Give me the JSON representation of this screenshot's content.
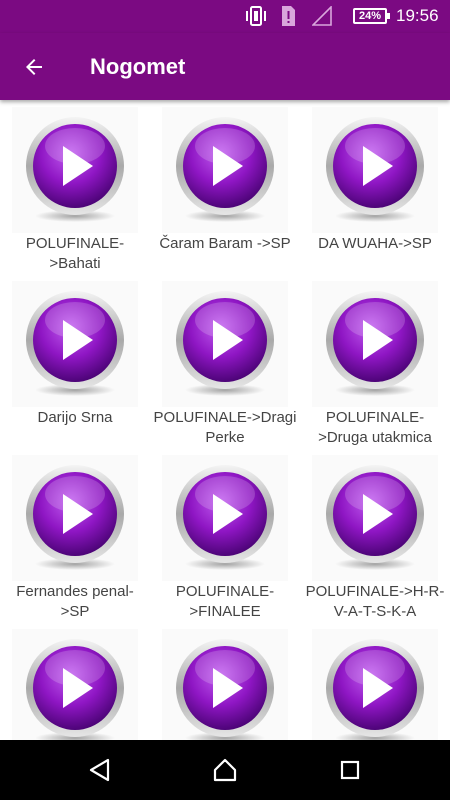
{
  "status_bar": {
    "battery": "24%",
    "time": "19:56"
  },
  "app_bar": {
    "title": "Nogomet"
  },
  "colors": {
    "primary": "#7b0a82",
    "play_purple": "#8f16c4",
    "label_text": "#444444"
  },
  "tiles": [
    {
      "label": "POLUFINALE->Bahati"
    },
    {
      "label": "Čaram Baram ->SP"
    },
    {
      "label": "DA WUAHA->SP"
    },
    {
      "label": "Darijo Srna"
    },
    {
      "label": "POLUFINALE->Dragi Perke"
    },
    {
      "label": "POLUFINALE->Druga utakmica"
    },
    {
      "label": "Fernandes penal->SP"
    },
    {
      "label": "POLUFINALE->FINALEE"
    },
    {
      "label": "POLUFINALE->H-R-V-A-T-S-K-A"
    },
    {
      "label": ""
    },
    {
      "label": ""
    },
    {
      "label": ""
    }
  ],
  "icons": {
    "back": "arrow-left-icon",
    "play": "play-button-icon",
    "nav_back": "triangle-back-icon",
    "nav_home": "home-icon",
    "nav_recents": "square-recents-icon"
  }
}
